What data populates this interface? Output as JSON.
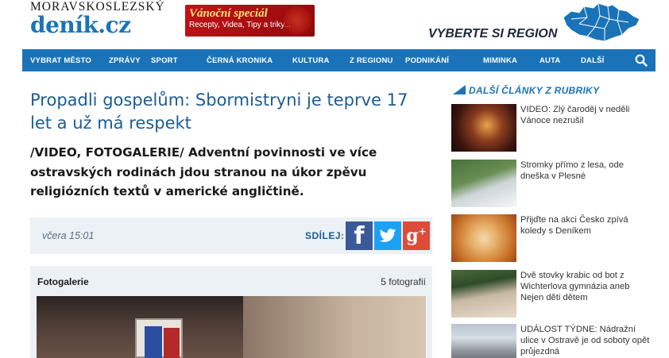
{
  "header": {
    "logo_top": "MORAVSKOSLEZSKÝ",
    "logo_main": "deník.cz",
    "promo_title": "Vánoční speciál",
    "promo_sub": "Recepty, Videa, Tipy a triky...",
    "region_label": "VYBERTE SI REGION"
  },
  "nav": {
    "items": [
      "VYBRAT MĚSTO",
      "ZPRÁVY",
      "SPORT",
      "ČERNÁ KRONIKA",
      "KULTURA",
      "Z REGIONU",
      "PODNIKÁNÍ",
      "MIMINKA",
      "AUTA",
      "DALŠÍ"
    ]
  },
  "article": {
    "headline": "Propadli gospelům: Sbormistryni je teprve 17 let a už má respekt",
    "perex": "/VIDEO, FOTOGALERIE/ Adventní povinnosti ve více ostravských rodinách jdou stranou na úkor zpěvu religiózních textů v americké angličtině.",
    "date": "včera 15:01",
    "share_label": "SDÍLEJ:",
    "gallery_title": "Fotogalerie",
    "gallery_count": "5 fotografií"
  },
  "sidebar": {
    "heading": "DALŠÍ ČLÁNKY Z RUBRIKY",
    "items": [
      {
        "title": "VIDEO: Zlý čaroděj v neděli Vánoce nezrušil"
      },
      {
        "title": "Stromky přímo z lesa, ode dneška v Plesné"
      },
      {
        "title": "Přijďte na akci Česko zpívá koledy s Deníkem"
      },
      {
        "title": "Dvě stovky krabic od bot z Wichterlova gymnázia aneb Nejen děti dětem"
      },
      {
        "title": "UDÁLOST TÝDNE: Nádražní ulice v Ostravě je od soboty opět průjezdná"
      }
    ]
  },
  "colors": {
    "brand_blue": "#1a73b8",
    "headline_blue": "#1a5c96",
    "facebook": "#3b5998",
    "twitter": "#1da1f2",
    "google_plus": "#dd4b39"
  },
  "icons": {
    "search": "search-icon",
    "map": "czech-map-icon",
    "facebook": "facebook-icon",
    "twitter": "twitter-icon",
    "google_plus": "google-plus-icon"
  }
}
